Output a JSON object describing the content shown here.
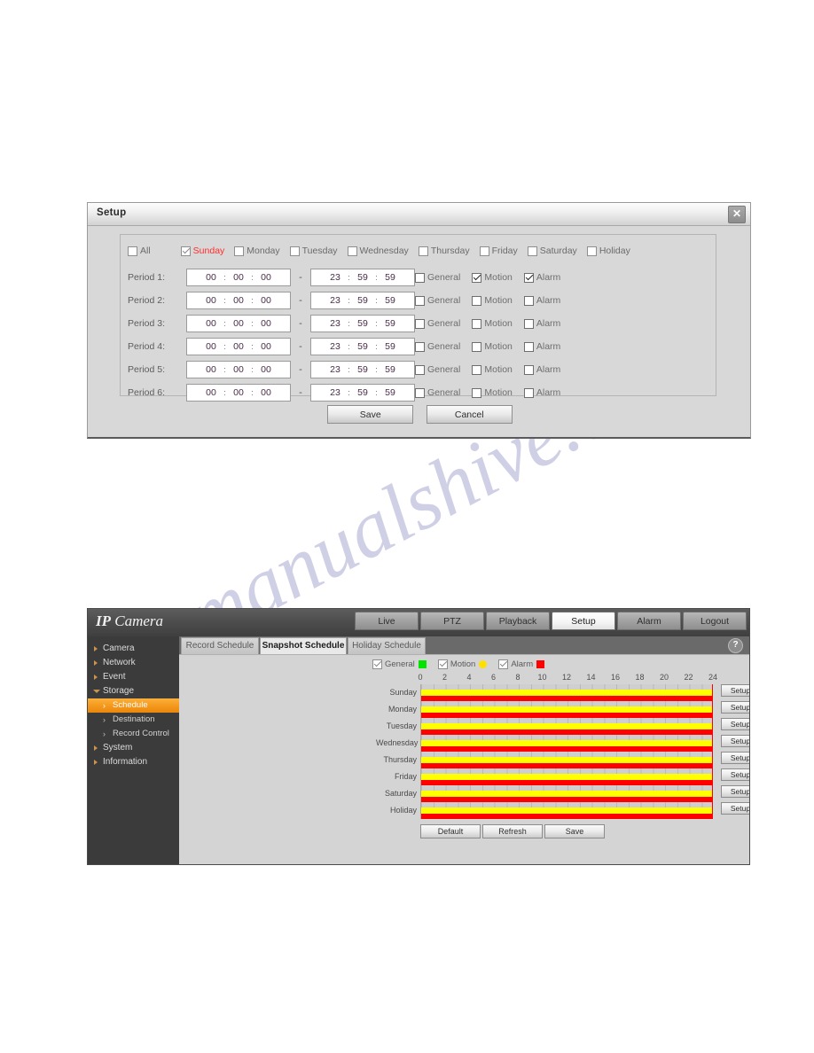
{
  "setup_dialog": {
    "title": "Setup",
    "close_label": "✕",
    "days": [
      {
        "label": "All",
        "checked": false,
        "selected": false
      },
      {
        "label": "Sunday",
        "checked": true,
        "selected": true
      },
      {
        "label": "Monday",
        "checked": false,
        "selected": false
      },
      {
        "label": "Tuesday",
        "checked": false,
        "selected": false
      },
      {
        "label": "Wednesday",
        "checked": false,
        "selected": false
      },
      {
        "label": "Thursday",
        "checked": false,
        "selected": false
      },
      {
        "label": "Friday",
        "checked": false,
        "selected": false
      },
      {
        "label": "Saturday",
        "checked": false,
        "selected": false
      },
      {
        "label": "Holiday",
        "checked": false,
        "selected": false
      }
    ],
    "separator": ":",
    "range_dash": "-",
    "event_labels": {
      "general": "General",
      "motion": "Motion",
      "alarm": "Alarm"
    },
    "periods": [
      {
        "label": "Period 1:",
        "start": {
          "h": "00",
          "m": "00",
          "s": "00"
        },
        "end": {
          "h": "23",
          "m": "59",
          "s": "59"
        },
        "general": false,
        "motion": true,
        "alarm": true
      },
      {
        "label": "Period 2:",
        "start": {
          "h": "00",
          "m": "00",
          "s": "00"
        },
        "end": {
          "h": "23",
          "m": "59",
          "s": "59"
        },
        "general": false,
        "motion": false,
        "alarm": false
      },
      {
        "label": "Period 3:",
        "start": {
          "h": "00",
          "m": "00",
          "s": "00"
        },
        "end": {
          "h": "23",
          "m": "59",
          "s": "59"
        },
        "general": false,
        "motion": false,
        "alarm": false
      },
      {
        "label": "Period 4:",
        "start": {
          "h": "00",
          "m": "00",
          "s": "00"
        },
        "end": {
          "h": "23",
          "m": "59",
          "s": "59"
        },
        "general": false,
        "motion": false,
        "alarm": false
      },
      {
        "label": "Period 5:",
        "start": {
          "h": "00",
          "m": "00",
          "s": "00"
        },
        "end": {
          "h": "23",
          "m": "59",
          "s": "59"
        },
        "general": false,
        "motion": false,
        "alarm": false
      },
      {
        "label": "Period 6:",
        "start": {
          "h": "00",
          "m": "00",
          "s": "00"
        },
        "end": {
          "h": "23",
          "m": "59",
          "s": "59"
        },
        "general": false,
        "motion": false,
        "alarm": false
      }
    ],
    "save_label": "Save",
    "cancel_label": "Cancel"
  },
  "app": {
    "logo_bold": "IP",
    "logo_rest": " Camera",
    "nav_buttons": [
      {
        "label": "Live",
        "active": false
      },
      {
        "label": "PTZ",
        "active": false
      },
      {
        "label": "Playback",
        "active": false
      },
      {
        "label": "Setup",
        "active": true
      },
      {
        "label": "Alarm",
        "active": false
      },
      {
        "label": "Logout",
        "active": false
      }
    ],
    "sidebar": [
      {
        "label": "Camera",
        "type": "top",
        "open": false
      },
      {
        "label": "Network",
        "type": "top",
        "open": false
      },
      {
        "label": "Event",
        "type": "top",
        "open": false
      },
      {
        "label": "Storage",
        "type": "top",
        "open": true
      },
      {
        "label": "Schedule",
        "type": "sub",
        "active": true
      },
      {
        "label": "Destination",
        "type": "sub",
        "active": false
      },
      {
        "label": "Record Control",
        "type": "sub",
        "active": false
      },
      {
        "label": "System",
        "type": "top",
        "open": false
      },
      {
        "label": "Information",
        "type": "top",
        "open": false
      }
    ],
    "tabs": [
      {
        "label": "Record Schedule",
        "active": false
      },
      {
        "label": "Snapshot Schedule",
        "active": true
      },
      {
        "label": "Holiday Schedule",
        "active": false
      }
    ],
    "help_label": "?",
    "legend": [
      {
        "label": "General",
        "color": "#00e400",
        "checked": true,
        "shape": "square"
      },
      {
        "label": "Motion",
        "color": "#ffe000",
        "checked": true,
        "shape": "round"
      },
      {
        "label": "Alarm",
        "color": "#ff0000",
        "checked": true,
        "shape": "square"
      }
    ],
    "ruler_ticks": [
      "0",
      "2",
      "4",
      "6",
      "8",
      "10",
      "12",
      "14",
      "16",
      "18",
      "20",
      "22",
      "24"
    ],
    "schedule_rows": [
      {
        "day": "Sunday",
        "setup_label": "Setup"
      },
      {
        "day": "Monday",
        "setup_label": "Setup"
      },
      {
        "day": "Tuesday",
        "setup_label": "Setup"
      },
      {
        "day": "Wednesday",
        "setup_label": "Setup"
      },
      {
        "day": "Thursday",
        "setup_label": "Setup"
      },
      {
        "day": "Friday",
        "setup_label": "Setup"
      },
      {
        "day": "Saturday",
        "setup_label": "Setup"
      },
      {
        "day": "Holiday",
        "setup_label": "Setup"
      }
    ],
    "actions": [
      {
        "label": "Default"
      },
      {
        "label": "Refresh"
      },
      {
        "label": "Save"
      }
    ]
  }
}
